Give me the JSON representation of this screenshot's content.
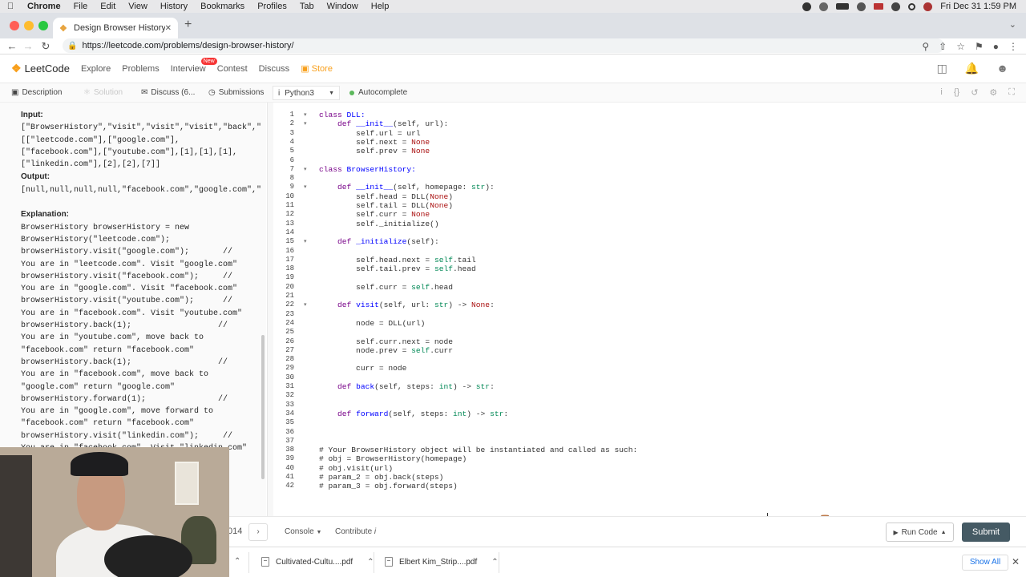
{
  "menubar": {
    "app": "Chrome",
    "items": [
      "File",
      "Edit",
      "View",
      "History",
      "Bookmarks",
      "Profiles",
      "Tab",
      "Window",
      "Help"
    ],
    "datetime": "Fri Dec 31  1:59 PM"
  },
  "browser": {
    "tab_title": "Design Browser History - Leet",
    "url": "https://leetcode.com/problems/design-browser-history/"
  },
  "leetcode": {
    "logo": "LeetCode",
    "nav": {
      "explore": "Explore",
      "problems": "Problems",
      "interview": "Interview",
      "new_badge": "New",
      "contest": "Contest",
      "discuss": "Discuss",
      "store": "Store"
    }
  },
  "toolbar": {
    "description": "Description",
    "solution": "Solution",
    "discuss": "Discuss (6...",
    "submissions": "Submissions",
    "language": "Python3",
    "autocomplete": "Autocomplete"
  },
  "description": {
    "input_label": "Input:",
    "input_lines": [
      "[\"BrowserHistory\",\"visit\",\"visit\",\"visit\",\"back\",\"",
      "[[\"leetcode.com\"],[\"google.com\"],",
      "[\"facebook.com\"],[\"youtube.com\"],[1],[1],[1],",
      "[\"linkedin.com\"],[2],[2],[7]]"
    ],
    "output_label": "Output:",
    "output_lines": [
      "[null,null,null,null,\"facebook.com\",\"google.com\",\""
    ],
    "explanation_label": "Explanation:",
    "explanation_lines": [
      "BrowserHistory browserHistory = new",
      "BrowserHistory(\"leetcode.com\");",
      "browserHistory.visit(\"google.com\");       //",
      "You are in \"leetcode.com\". Visit \"google.com\"",
      "browserHistory.visit(\"facebook.com\");     //",
      "You are in \"google.com\". Visit \"facebook.com\"",
      "browserHistory.visit(\"youtube.com\");      //",
      "You are in \"facebook.com\". Visit \"youtube.com\"",
      "browserHistory.back(1);                  //",
      "You are in \"youtube.com\", move back to",
      "\"facebook.com\" return \"facebook.com\"",
      "browserHistory.back(1);                  //",
      "You are in \"facebook.com\", move back to",
      "\"google.com\" return \"google.com\"",
      "browserHistory.forward(1);               //",
      "You are in \"google.com\", move forward to",
      "\"facebook.com\" return \"facebook.com\"",
      "browserHistory.visit(\"linkedin.com\");     //",
      "You are in \"facebook.com\". Visit \"linkedin.com\""
    ]
  },
  "code_lines": [
    [
      {
        "t": "class ",
        "c": "kw"
      },
      {
        "t": "DLL:",
        "c": "df"
      }
    ],
    [
      {
        "t": "    "
      },
      {
        "t": "def ",
        "c": "kw"
      },
      {
        "t": "__init__",
        "c": "df"
      },
      {
        "t": "(self, url):"
      }
    ],
    [
      {
        "t": "        self.url = url"
      }
    ],
    [
      {
        "t": "        self.next = "
      },
      {
        "t": "None",
        "c": "nn"
      }
    ],
    [
      {
        "t": "        self.prev = "
      },
      {
        "t": "None",
        "c": "nn"
      }
    ],
    [],
    [
      {
        "t": "class ",
        "c": "kw"
      },
      {
        "t": "BrowserHistory:",
        "c": "df"
      }
    ],
    [],
    [
      {
        "t": "    "
      },
      {
        "t": "def ",
        "c": "kw"
      },
      {
        "t": "__init__",
        "c": "df"
      },
      {
        "t": "(self, homepage: "
      },
      {
        "t": "str",
        "c": "tp"
      },
      {
        "t": "):"
      }
    ],
    [
      {
        "t": "        self.head = DLL("
      },
      {
        "t": "None",
        "c": "nn"
      },
      {
        "t": ")"
      }
    ],
    [
      {
        "t": "        self.tail = DLL("
      },
      {
        "t": "None",
        "c": "nn"
      },
      {
        "t": ")"
      }
    ],
    [
      {
        "t": "        self.curr = "
      },
      {
        "t": "None",
        "c": "nn"
      }
    ],
    [
      {
        "t": "        self._initialize()"
      }
    ],
    [],
    [
      {
        "t": "    "
      },
      {
        "t": "def ",
        "c": "kw"
      },
      {
        "t": "_initialize",
        "c": "df"
      },
      {
        "t": "(self):"
      }
    ],
    [],
    [
      {
        "t": "        self.head.next = "
      },
      {
        "t": "self",
        "c": "tp"
      },
      {
        "t": ".tail"
      }
    ],
    [
      {
        "t": "        self.tail.prev = "
      },
      {
        "t": "self",
        "c": "tp"
      },
      {
        "t": ".head"
      }
    ],
    [],
    [
      {
        "t": "        self.curr = "
      },
      {
        "t": "self",
        "c": "tp"
      },
      {
        "t": ".head"
      }
    ],
    [],
    [
      {
        "t": "    "
      },
      {
        "t": "def ",
        "c": "kw"
      },
      {
        "t": "visit",
        "c": "df"
      },
      {
        "t": "(self, url: "
      },
      {
        "t": "str",
        "c": "tp"
      },
      {
        "t": ") -> "
      },
      {
        "t": "None",
        "c": "nn"
      },
      {
        "t": ":"
      }
    ],
    [],
    [
      {
        "t": "        node = DLL(url)"
      }
    ],
    [],
    [
      {
        "t": "        self.curr.next = node"
      }
    ],
    [
      {
        "t": "        node.prev = "
      },
      {
        "t": "self",
        "c": "tp"
      },
      {
        "t": ".curr"
      }
    ],
    [],
    [
      {
        "t": "        curr = node"
      }
    ],
    [],
    [
      {
        "t": "    "
      },
      {
        "t": "def ",
        "c": "kw"
      },
      {
        "t": "back",
        "c": "df"
      },
      {
        "t": "(self, steps: "
      },
      {
        "t": "int",
        "c": "tp"
      },
      {
        "t": ") -> "
      },
      {
        "t": "str",
        "c": "tp"
      },
      {
        "t": ":"
      }
    ],
    [],
    [],
    [
      {
        "t": "    "
      },
      {
        "t": "def ",
        "c": "kw"
      },
      {
        "t": "forward",
        "c": "df"
      },
      {
        "t": "(self, steps: "
      },
      {
        "t": "int",
        "c": "tp"
      },
      {
        "t": ") -> "
      },
      {
        "t": "str",
        "c": "tp"
      },
      {
        "t": ":"
      }
    ],
    [],
    [],
    [],
    [
      {
        "t": "# Your BrowserHistory object will be instantiated and called as such:",
        "c": "cm"
      }
    ],
    [
      {
        "t": "# obj = BrowserHistory(homepage)",
        "c": "cm"
      }
    ],
    [
      {
        "t": "# obj.visit(url)",
        "c": "cm"
      }
    ],
    [
      {
        "t": "# param_2 = obj.back(steps)",
        "c": "cm"
      }
    ],
    [
      {
        "t": "# param_3 = obj.forward(steps)",
        "c": "cm"
      }
    ]
  ],
  "fold_lines": [
    1,
    2,
    7,
    9,
    15,
    22
  ],
  "bottom": {
    "page_num": "014",
    "console": "Console",
    "contribute": "Contribute",
    "run_code": "Run Code",
    "submit": "Submit"
  },
  "downloads": {
    "items": [
      "Cultivated-Cultu....pdf",
      "Elbert Kim_Strip....pdf"
    ],
    "show_all": "Show All"
  }
}
